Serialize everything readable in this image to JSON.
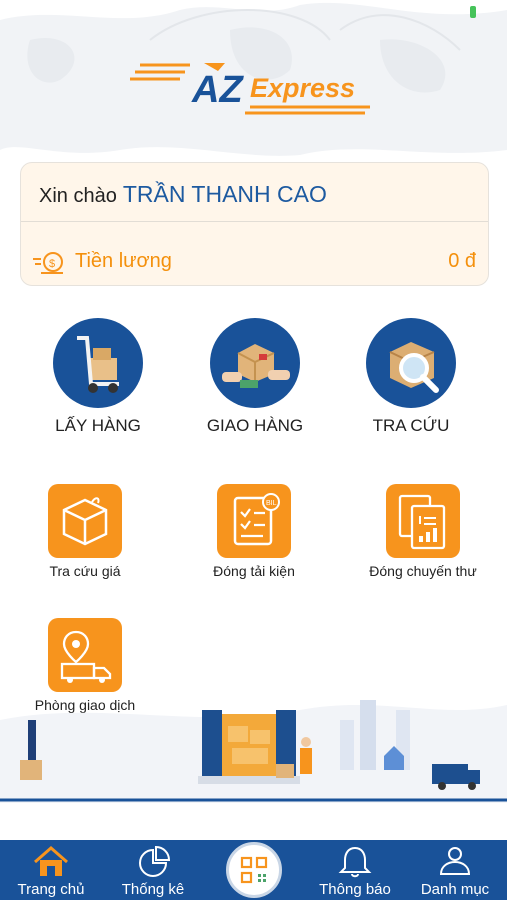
{
  "logo": {
    "az": "AZ",
    "express": "Express"
  },
  "greeting": {
    "prefix": "Xin chào",
    "name": "TRẦN THANH CAO"
  },
  "salary": {
    "label": "Tiền lương",
    "value": "0 đ"
  },
  "main_actions": [
    {
      "label": "LẤY HÀNG",
      "icon": "hand-truck-icon"
    },
    {
      "label": "GIAO HÀNG",
      "icon": "package-handover-icon"
    },
    {
      "label": "TRA CỨU",
      "icon": "box-search-icon"
    }
  ],
  "tools": [
    {
      "label": "Tra cứu giá",
      "icon": "box-icon"
    },
    {
      "label": "Đóng tải kiện",
      "icon": "bill-list-icon"
    },
    {
      "label": "Đóng chuyến thư",
      "icon": "documents-icon"
    },
    {
      "label": "Phòng giao dịch",
      "icon": "delivery-location-icon"
    }
  ],
  "nav": [
    {
      "label": "Trang chủ",
      "icon": "home-icon"
    },
    {
      "label": "Thống kê",
      "icon": "chart-icon"
    },
    {
      "label": "",
      "icon": "qr-code-icon"
    },
    {
      "label": "Thông báo",
      "icon": "bell-icon"
    },
    {
      "label": "Danh mục",
      "icon": "user-icon"
    }
  ],
  "colors": {
    "primary": "#195299",
    "accent": "#f7941d",
    "nav_bg": "#195299",
    "status": "#46c35a"
  }
}
